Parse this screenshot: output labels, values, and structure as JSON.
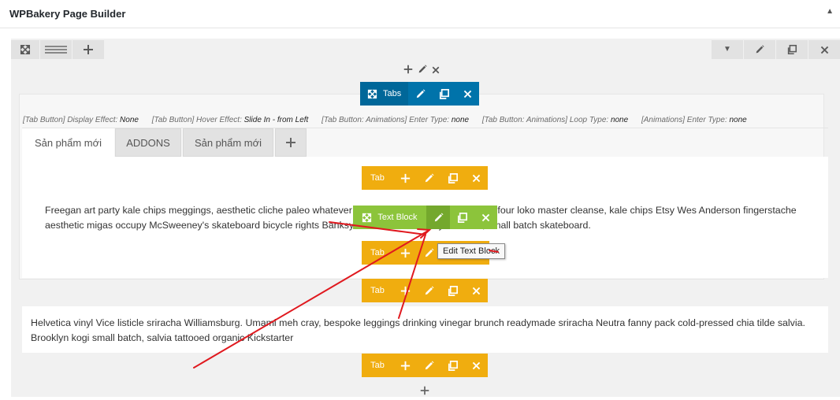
{
  "header": {
    "title": "WPBakery Page Builder",
    "collapse_icon": "triangle-up-icon"
  },
  "toolbar": {
    "left_icons": [
      "fullscreen-icon",
      "layout-lines-icon",
      "plus-icon"
    ],
    "right_icons": [
      "caret-down-icon",
      "pencil-icon",
      "clone-icon",
      "close-icon"
    ]
  },
  "tabs_element": {
    "label": "Tabs"
  },
  "effects": [
    {
      "key": "[Tab Button] Display Effect: ",
      "value": "None"
    },
    {
      "key": "[Tab Button] Hover Effect: ",
      "value": "Slide In - from Left"
    },
    {
      "key": "[Tab Button: Animations] Enter Type: ",
      "value": "none"
    },
    {
      "key": "[Tab Button: Animations] Loop Type: ",
      "value": "none"
    },
    {
      "key": "[Animations] Enter Type: ",
      "value": "none"
    }
  ],
  "tabs": [
    {
      "label": "Sản phẩm mới",
      "active": true
    },
    {
      "label": "ADDONS",
      "active": false
    },
    {
      "label": "Sản phẩm mới",
      "active": false
    }
  ],
  "tab_control": {
    "label": "Tab"
  },
  "text_block_control": {
    "label": "Text Block"
  },
  "tooltip": {
    "text": "Edit Text Block"
  },
  "paragraph1": "Freegan art party kale chips meggings, aesthetic cliche paleo whatever craft beer hella leggings. Deep v four loko master cleanse, kale chips Etsy Wes Anderson fingerstache aesthetic migas occupy McSweeney's skateboard bicycle rights Banksy farm-to-table lomo yr Truffaut, small batch skateboard.",
  "paragraph2": "Helvetica vinyl Vice listicle sriracha Williamsburg. Umami meh cray, bespoke leggings drinking vinegar brunch readymade sriracha Neutra fanny pack cold-pressed chia tilde salvia. Brooklyn kogi small batch, salvia tattooed organic Kickstarter",
  "colors": {
    "tabs_blue": "#0073aa",
    "tab_orange": "#f0ad0f",
    "text_block_green": "#8cc43b",
    "annotation_red": "#e0191f"
  }
}
